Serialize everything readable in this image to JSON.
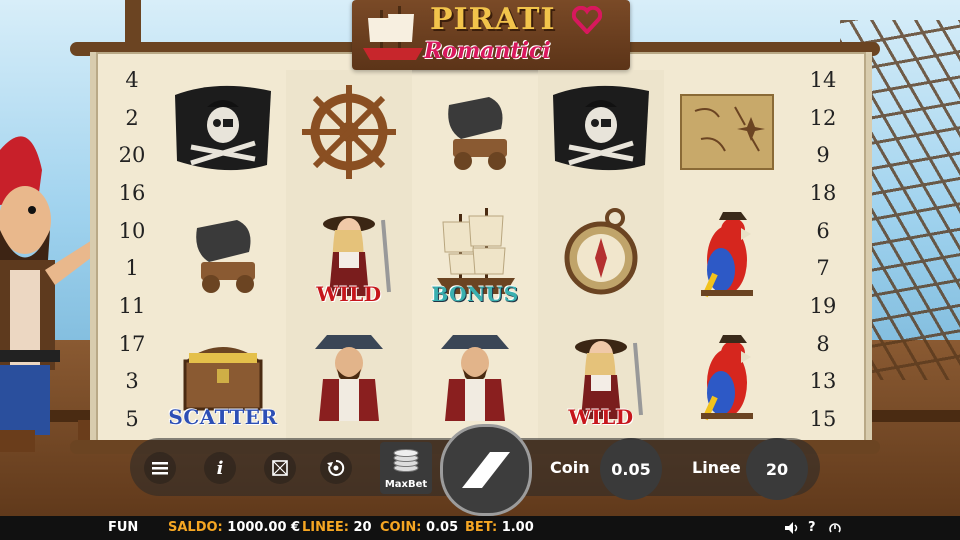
{
  "title": {
    "line1": "PIRATI",
    "line2": "Romantici"
  },
  "lines_left": [
    "4",
    "2",
    "20",
    "16",
    "10",
    "1",
    "11",
    "17",
    "3",
    "5"
  ],
  "lines_right": [
    "14",
    "12",
    "9",
    "18",
    "6",
    "7",
    "19",
    "8",
    "13",
    "15"
  ],
  "reels": [
    [
      {
        "symbol": "jolly-roger",
        "label": ""
      },
      {
        "symbol": "cannon",
        "label": ""
      },
      {
        "symbol": "treasure-chest",
        "label": "SCATTER"
      }
    ],
    [
      {
        "symbol": "ship-wheel",
        "label": ""
      },
      {
        "symbol": "pirate-woman",
        "label": "WILD"
      },
      {
        "symbol": "pirate-man",
        "label": ""
      }
    ],
    [
      {
        "symbol": "cannon",
        "label": ""
      },
      {
        "symbol": "ship",
        "label": "BONUS"
      },
      {
        "symbol": "pirate-man",
        "label": ""
      }
    ],
    [
      {
        "symbol": "jolly-roger",
        "label": ""
      },
      {
        "symbol": "compass",
        "label": ""
      },
      {
        "symbol": "pirate-woman",
        "label": "WILD"
      }
    ],
    [
      {
        "symbol": "treasure-map",
        "label": ""
      },
      {
        "symbol": "parrot",
        "label": ""
      },
      {
        "symbol": "parrot",
        "label": ""
      }
    ]
  ],
  "controls": {
    "menu_icon": "hamburger-icon",
    "info_label": "i",
    "maxbet_label": "MaxBet",
    "coin_label": "Coin",
    "coin_value": "0.05",
    "lines_label": "Linee",
    "lines_value": "20"
  },
  "status_bar": {
    "mode": "FUN",
    "saldo_label": "SALDO:",
    "saldo_value": "1000.00 €",
    "linee_label": "LINEE:",
    "linee_value": "20",
    "coin_label": "COIN:",
    "coin_value": "0.05",
    "bet_label": "BET:",
    "bet_value": "1.00",
    "sound_icon": "speaker-icon",
    "help_label": "?"
  },
  "colors": {
    "wild": "#c6161b",
    "bonus": "#3ab0b0",
    "scatter": "#2d4fb5",
    "status_key": "#f5a623"
  }
}
